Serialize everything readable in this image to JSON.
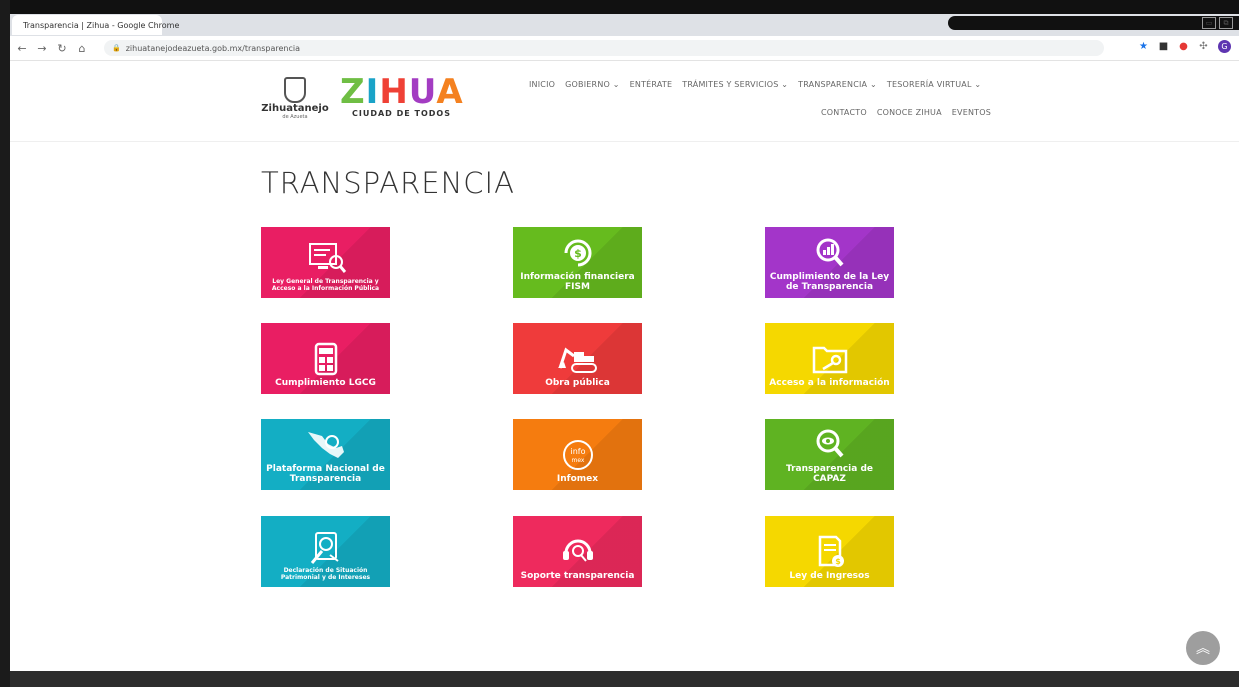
{
  "browser": {
    "tab_title": "Transparencia | Zihua - Google Chrome",
    "url": "zihuatanejodeazueta.gob.mx/transparencia",
    "profile_initial": "G"
  },
  "header": {
    "muni_name": "Zihuatanejo",
    "muni_sub": "de Azueta",
    "brand": "ZIHUA",
    "brand_sub": "CIUDAD DE TODOS",
    "nav_primary": [
      "INICIO",
      "GOBIERNO",
      "ENTÉRATE",
      "TRÁMITES Y SERVICIOS",
      "TRANSPARENCIA",
      "TESORERÍA VIRTUAL"
    ],
    "nav_secondary": [
      "CONTACTO",
      "CONOCE ZIHUA",
      "EVENTOS"
    ]
  },
  "main": {
    "title": "TRANSPARENCIA",
    "tiles": [
      {
        "label": "Ley General de Transparencia y Acceso a la Información Pública",
        "icon": "monitor-search-icon",
        "color": "#e91e63"
      },
      {
        "label": "Información financiera FISM",
        "icon": "money-icon",
        "color": "#66bb1e"
      },
      {
        "label": "Cumplimiento de la Ley de Transparencia",
        "icon": "chart-search-icon",
        "color": "#a335c9"
      },
      {
        "label": "Cumplimiento LGCG",
        "icon": "calculator-icon",
        "color": "#e91e63"
      },
      {
        "label": "Obra pública",
        "icon": "excavator-icon",
        "color": "#ef3b3b"
      },
      {
        "label": "Acceso a la información",
        "icon": "folder-key-icon",
        "color": "#f5d800"
      },
      {
        "label": "Plataforma Nacional de Transparencia",
        "icon": "mexico-map-icon",
        "color": "#13aec4"
      },
      {
        "label": "Infomex",
        "icon": "infomex-icon",
        "color": "#f57c0f"
      },
      {
        "label": "Transparencia de CAPAZ",
        "icon": "eye-search-icon",
        "color": "#5fb322"
      },
      {
        "label": "Declaración de Situación Patrimonial y de Intereses",
        "icon": "document-search-icon",
        "color": "#13aec4"
      },
      {
        "label": "Soporte transparencia",
        "icon": "support-icon",
        "color": "#ee2a5d"
      },
      {
        "label": "Ley de Ingresos",
        "icon": "document-money-icon",
        "color": "#f5d800"
      }
    ]
  },
  "colors": {
    "zihua_z": "#6fbe44",
    "zihua_i": "#1aa3c8",
    "zihua_h": "#ef4136",
    "zihua_u": "#a33cc2",
    "zihua_a": "#f48120"
  }
}
